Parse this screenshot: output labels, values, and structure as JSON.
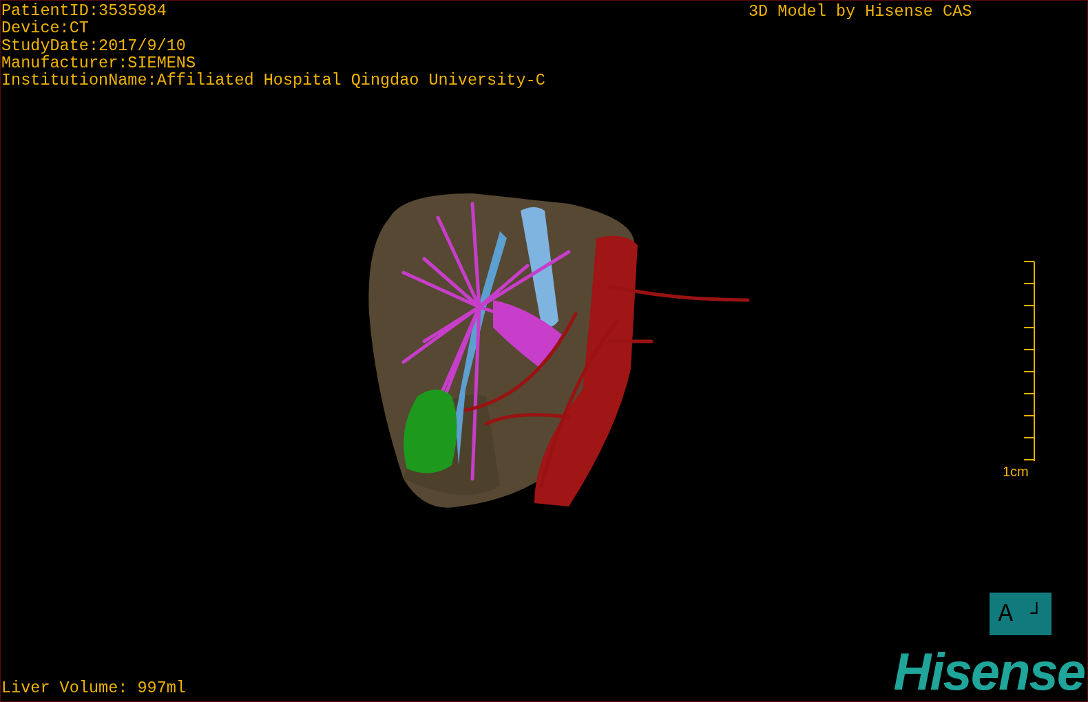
{
  "info_lines": [
    "PatientID:3535984",
    "Device:CT",
    "StudyDate:2017/9/10",
    "Manufacturer:SIEMENS",
    "InstitutionName:Affiliated Hospital Qingdao University-C"
  ],
  "credit": "3D Model by Hisense CAS",
  "scale_bar": {
    "label": "1cm"
  },
  "orientation_marker": {
    "letter": "A",
    "corner": "┘"
  },
  "liver_volume": "Liver Volume: 997ml",
  "logo": "Hisense"
}
